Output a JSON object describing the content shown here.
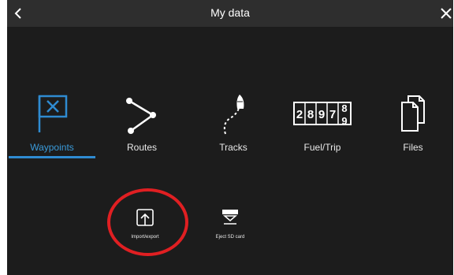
{
  "header": {
    "title": "My data",
    "back_icon": "back-chevron-icon",
    "close_icon": "close-icon"
  },
  "tiles": [
    {
      "label": "Waypoints",
      "icon": "waypoint-flag-icon",
      "active": true
    },
    {
      "label": "Routes",
      "icon": "route-icon",
      "active": false
    },
    {
      "label": "Tracks",
      "icon": "track-icon",
      "active": false
    },
    {
      "label": "Fuel/Trip",
      "icon": "fuel-trip-counter-icon",
      "active": false,
      "counter_digits": [
        "2",
        "8",
        "9",
        "7",
        "8",
        "9"
      ]
    },
    {
      "label": "Files",
      "icon": "files-icon",
      "active": false
    }
  ],
  "actions": [
    {
      "label": "Import/export",
      "icon": "import-export-icon",
      "highlighted": true
    },
    {
      "label": "Eject SD card",
      "icon": "eject-sd-card-icon",
      "highlighted": false
    }
  ],
  "colors": {
    "accent": "#2f8bd1",
    "active_label": "#3a9ad9",
    "highlight_ring": "#e01f22",
    "background": "#1c1c1c",
    "titlebar": "#2e2e2e"
  }
}
